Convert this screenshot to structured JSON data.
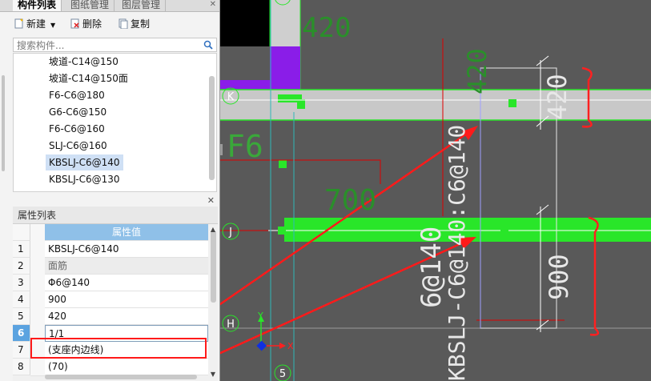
{
  "tabs": {
    "items": [
      "构件列表",
      "图纸管理",
      "图层管理"
    ],
    "active": 0
  },
  "toolbar": {
    "new_label": "新建",
    "delete_label": "删除",
    "copy_label": "复制"
  },
  "search": {
    "placeholder": "搜索构件..."
  },
  "component_list": {
    "items": [
      "坡道-C14@150",
      "坡道-C14@150面",
      "F6-C6@180",
      "G6-C6@150",
      "F6-C6@160",
      "SLJ-C6@160",
      "KBSLJ-C6@140",
      "KBSLJ-C6@130"
    ],
    "selected": "KBSLJ-C6@140"
  },
  "props": {
    "title": "属性列表",
    "header_value": "属性值",
    "rows": [
      {
        "num": "1",
        "value": "KBSLJ-C6@140"
      },
      {
        "num": "2",
        "value": "面筋"
      },
      {
        "num": "3",
        "value": "Φ6@140"
      },
      {
        "num": "4",
        "value": "900"
      },
      {
        "num": "5",
        "value": "420"
      },
      {
        "num": "6",
        "value": "1/1"
      },
      {
        "num": "7",
        "value": "(支座内边线)"
      },
      {
        "num": "8",
        "value": "(70)"
      }
    ],
    "selected_row": "6"
  },
  "drawing": {
    "axis_labels": [
      "K",
      "J",
      "H",
      "5"
    ],
    "dim_labels": [
      "420",
      "700",
      "900",
      "420",
      "420",
      "6@140"
    ],
    "text_f6": "F6",
    "rebar_label": "KBSLJ-C6@140:C6@140",
    "ucs_x": "X",
    "ucs_y": "Y"
  },
  "colors": {
    "canvas_bg": "#595959",
    "green": "#29e629",
    "purple": "#8a1de8",
    "red_annotation": "#ff1a1a",
    "dim_text": "#39a839",
    "selected_row": "#5ba3e0",
    "header_blue": "#8fc0e8"
  }
}
